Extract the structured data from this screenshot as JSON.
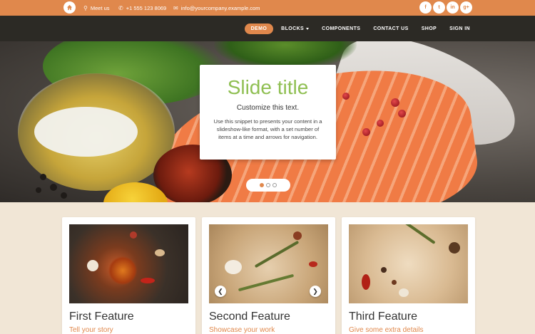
{
  "topbar": {
    "location_label": "Meet us",
    "phone": "+1 555 123 8069",
    "email": "info@yourcompany.example.com",
    "socials": [
      "f",
      "t",
      "in",
      "g+"
    ]
  },
  "nav": {
    "items": [
      "DEMO",
      "BLOCKS",
      "COMPONENTS",
      "CONTACT US",
      "SHOP",
      "SIGN IN"
    ],
    "active": "DEMO"
  },
  "slider": {
    "title": "Slide title",
    "subtitle": "Customize this text.",
    "text": "Use this snippet to presents your content in a slideshow-like format, with a set number of items at a time and arrows for navigation.",
    "slide_count": 3,
    "active_slide": 1
  },
  "features": [
    {
      "title": "First Feature",
      "subtitle": "Tell your story"
    },
    {
      "title": "Second Feature",
      "subtitle": "Showcase your work"
    },
    {
      "title": "Third Feature",
      "subtitle": "Give some extra details"
    }
  ],
  "colors": {
    "accent": "#e0884c",
    "navbar": "#2c2a25",
    "page_bg": "#f1e6d6",
    "slide_title": "#8fbf52"
  }
}
